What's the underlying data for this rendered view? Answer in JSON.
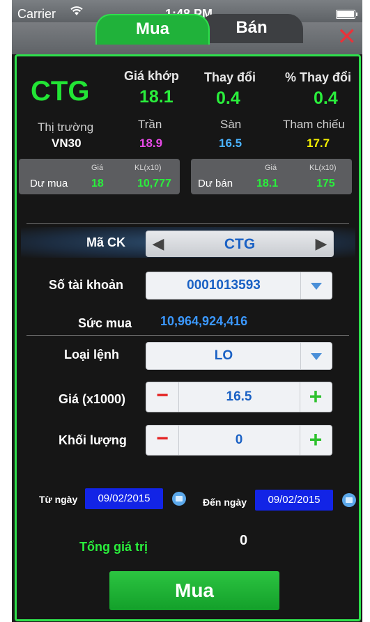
{
  "status": {
    "carrier": "Carrier",
    "time": "1:48 PM"
  },
  "tabs": {
    "buy": "Mua",
    "sell": "Bán"
  },
  "quote": {
    "symbol": "CTG",
    "match_label": "Giá khớp",
    "match_value": "18.1",
    "change_label": "Thay đổi",
    "change_value": "0.4",
    "pct_label": "% Thay đổi",
    "pct_value": "0.4",
    "market_label": "Thị trường",
    "market_value": "VN30",
    "ceiling_label": "Trần",
    "ceiling_value": "18.9",
    "floor_label": "Sàn",
    "floor_value": "16.5",
    "ref_label": "Tham chiếu",
    "ref_value": "17.7"
  },
  "bid": {
    "label": "Dư mua",
    "price_hdr": "Giá",
    "vol_hdr": "KL(x10)",
    "price": "18",
    "volume": "10,777"
  },
  "ask": {
    "label": "Dư bán",
    "price_hdr": "Giá",
    "vol_hdr": "KL(x10)",
    "price": "18.1",
    "volume": "175"
  },
  "form": {
    "symbol_label": "Mã CK",
    "symbol_value": "CTG",
    "account_label": "Số tài khoản",
    "account_value": "0001013593",
    "power_label": "Sức mua",
    "power_value": "10,964,924,416",
    "order_type_label": "Loại lệnh",
    "order_type_value": "LO",
    "price_label": "Giá (x1000)",
    "price_value": "16.5",
    "qty_label": "Khối lượng",
    "qty_value": "0",
    "from_label": "Từ ngày",
    "from_value": "09/02/2015",
    "to_label": "Đến ngày",
    "to_value": "09/02/2015",
    "total_label": "Tổng giá trị",
    "total_value": "0",
    "submit_label": "Mua"
  },
  "icons": {
    "minus": "−",
    "plus": "+",
    "close": "✕",
    "left": "◀",
    "right": "▶",
    "wifi": "wifi-icon"
  },
  "colors": {
    "accent": "#2ee04c",
    "ceiling": "#e84ae8",
    "floor": "#4ab3ff",
    "reference": "#f4f000",
    "sell_red": "#e42020"
  }
}
